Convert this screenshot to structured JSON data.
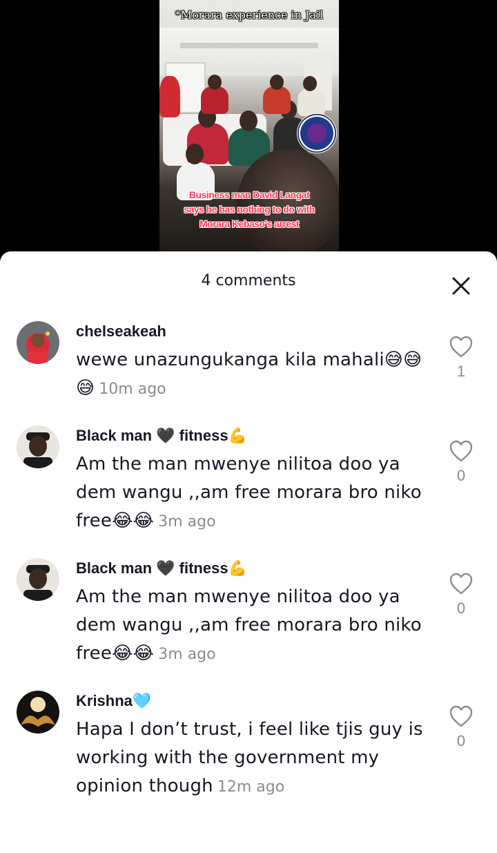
{
  "video": {
    "title_overlay": "*Morara experience in Jail",
    "caption_lines": [
      "Business man David Langat",
      "says he has nothing to do with",
      "Morara Kebaso's arrest"
    ]
  },
  "comments_panel": {
    "header": "4 comments",
    "close_icon": "close-icon"
  },
  "comments": [
    {
      "username": "chelseakeah",
      "text": "wewe unazungukanga kila mahali😅😅😅",
      "time": "10m ago",
      "likes": "1"
    },
    {
      "username": "Black man 🖤 fitness💪",
      "text": "Am the man mwenye nilitoa doo ya dem wangu ,,am free morara bro niko free😂😂",
      "time": "3m ago",
      "likes": "0"
    },
    {
      "username": "Black man 🖤 fitness💪",
      "text": "Am the man mwenye nilitoa doo ya dem wangu ,,am free morara bro niko free😂😂",
      "time": "3m ago",
      "likes": "0"
    },
    {
      "username": "Krishna🩵",
      "text": "Hapa I don’t trust, i feel like tjis guy is working with the government my opinion though",
      "time": "12m ago",
      "likes": "0"
    }
  ],
  "colors": {
    "text": "#161823",
    "secondary": "#8a8b91",
    "caption": "#ff3a55"
  }
}
